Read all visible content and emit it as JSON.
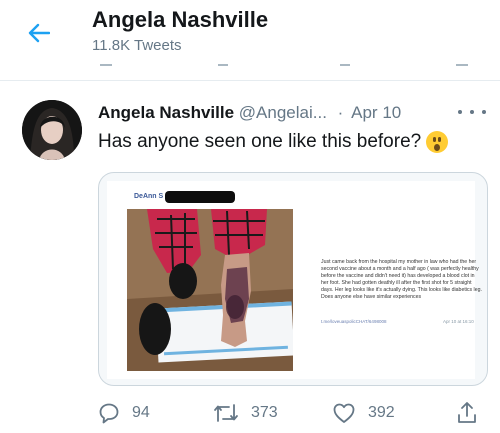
{
  "header": {
    "back_icon": "arrow-left-icon",
    "name": "Angela Nashville",
    "tweet_count": "11.8K Tweets"
  },
  "tweet": {
    "author_name": "Angela Nashville",
    "author_handle": "@Angelai...",
    "separator": "·",
    "date": "Apr 10",
    "text": "Has anyone seen one like this before?",
    "emoji": "face-with-open-mouth-icon"
  },
  "embedded_post": {
    "poster_name": "DeAnn S",
    "body": "Just came back from the hospital my mother in law who had the her second vaccine about a month and a half ago ( was perfectly healthy before the vaccine and didn't need it) has developed a blood clot in her foot. She had gotten deathly ill after the first shot for 5 straight days. Her leg looks like it's actually dying. This looks like diabetics leg. Does anyone else have similar experiences",
    "link": "t.me/loveuaspolicCHAT/6498008",
    "timestamp": "Apr 10 at 16:10"
  },
  "actions": {
    "replies": "94",
    "retweets": "373",
    "likes": "392"
  },
  "colors": {
    "accent": "#1da1f2",
    "text": "#14171a",
    "muted": "#657786",
    "emoji": "#ffcc33"
  }
}
